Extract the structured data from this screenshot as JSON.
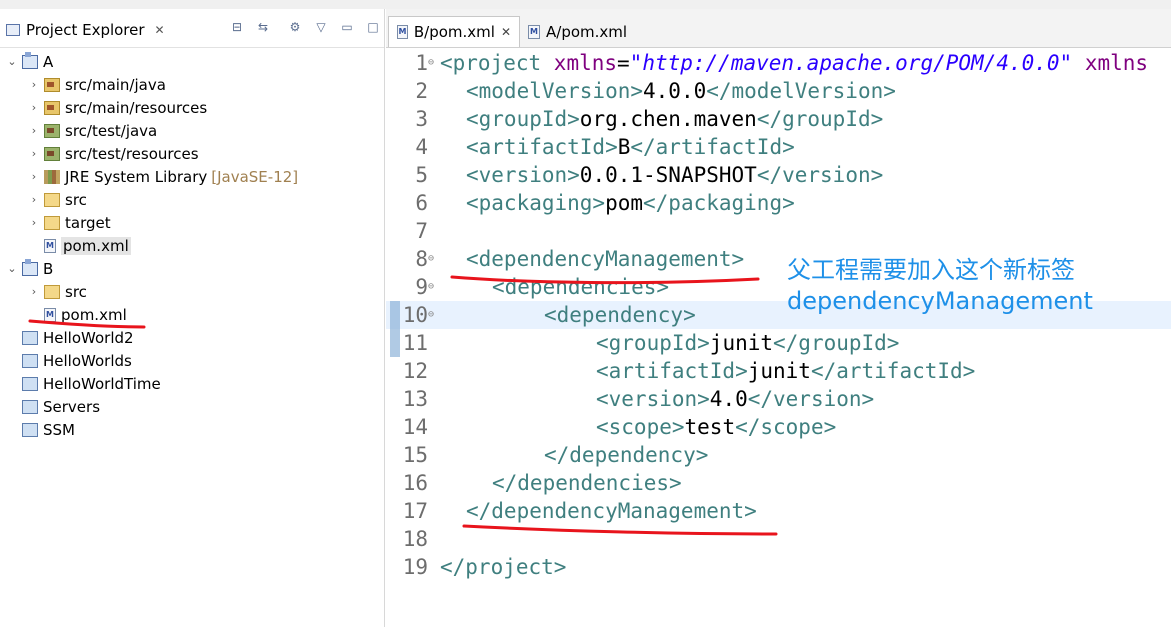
{
  "left_view": {
    "tab_title": "Project Explorer",
    "tab_close": "✕"
  },
  "tree": [
    {
      "label": "A",
      "icon": "project-icon",
      "twisty": "v"
    },
    {
      "label": "src/main/java",
      "icon": "source-folder-icon",
      "twisty": ">"
    },
    {
      "label": "src/main/resources",
      "icon": "source-folder-icon",
      "twisty": ">"
    },
    {
      "label": "src/test/java",
      "icon": "test-source-folder-icon",
      "twisty": ">"
    },
    {
      "label": "src/test/resources",
      "icon": "test-source-folder-icon",
      "twisty": ">"
    },
    {
      "label": "JRE System Library",
      "decoration": "[JavaSE-12]",
      "icon": "library-icon",
      "twisty": ">"
    },
    {
      "label": "src",
      "icon": "folder-icon",
      "twisty": ">"
    },
    {
      "label": "target",
      "icon": "folder-icon",
      "twisty": ">"
    },
    {
      "label": "pom.xml",
      "icon": "maven-file-icon",
      "twisty": ""
    },
    {
      "label": "B",
      "icon": "project-icon",
      "twisty": "v"
    },
    {
      "label": "src",
      "icon": "folder-icon",
      "twisty": ">"
    },
    {
      "label": "pom.xml",
      "icon": "maven-file-icon",
      "twisty": ""
    },
    {
      "label": "HelloWorld2",
      "icon": "closed-project-icon",
      "twisty": ""
    },
    {
      "label": "HelloWorlds",
      "icon": "closed-project-icon",
      "twisty": ""
    },
    {
      "label": "HelloWorldTime",
      "icon": "closed-project-icon",
      "twisty": ""
    },
    {
      "label": "Servers",
      "icon": "closed-project-icon",
      "twisty": ""
    },
    {
      "label": "SSM",
      "icon": "closed-project-icon",
      "twisty": ""
    }
  ],
  "editor": {
    "tabs": [
      {
        "label": "B/pom.xml",
        "close": "✕"
      },
      {
        "label": "A/pom.xml"
      }
    ],
    "lines": [
      {
        "n": "1",
        "fold": "⊖"
      },
      {
        "n": "2"
      },
      {
        "n": "3"
      },
      {
        "n": "4"
      },
      {
        "n": "5"
      },
      {
        "n": "6"
      },
      {
        "n": "7"
      },
      {
        "n": "8",
        "fold": "⊖"
      },
      {
        "n": "9",
        "fold": "⊖"
      },
      {
        "n": "10",
        "fold": "⊖"
      },
      {
        "n": "11"
      },
      {
        "n": "12"
      },
      {
        "n": "13"
      },
      {
        "n": "14"
      },
      {
        "n": "15"
      },
      {
        "n": "16"
      },
      {
        "n": "17"
      },
      {
        "n": "18"
      },
      {
        "n": "19"
      }
    ],
    "code": {
      "l1_open": "<project ",
      "l1_attr": "xmlns",
      "l1_eq": "=",
      "l1_val": "\"http://maven.apache.org/POM/4.0.0\"",
      "l1_attr2": " xmlns",
      "l2_open": "<modelVersion>",
      "l2_text": "4.0.0",
      "l2_close": "</modelVersion>",
      "l3_open": "<groupId>",
      "l3_text": "org.chen.maven",
      "l3_close": "</groupId>",
      "l4_open": "<artifactId>",
      "l4_text": "B",
      "l4_close": "</artifactId>",
      "l5_open": "<version>",
      "l5_text": "0.0.1-SNAPSHOT",
      "l5_close": "</version>",
      "l6_open": "<packaging>",
      "l6_text": "pom",
      "l6_close": "</packaging>",
      "l8": "<dependencyManagement>",
      "l9": "<dependencies>",
      "l10": "<dependency>",
      "l11_open": "<groupId>",
      "l11_text": "junit",
      "l11_close": "</groupId>",
      "l12_open": "<artifactId>",
      "l12_text": "junit",
      "l12_close": "</artifactId>",
      "l13_open": "<version>",
      "l13_text": "4.0",
      "l13_close": "</version>",
      "l14_open": "<scope>",
      "l14_text": "test",
      "l14_close": "</scope>",
      "l15": "</dependency>",
      "l16": "</dependencies>",
      "l17": "</dependencyManagement>",
      "l19": "</project>"
    }
  },
  "annotation": {
    "line1": "父工程需要加入这个新标签",
    "line2": "dependencyManagement",
    "color": "#1e90e8",
    "underline_color": "#e8141c"
  },
  "colors": {
    "tag": "#3f7f7f",
    "attribute": "#7f007f",
    "string": "#2a00ff",
    "current_line": "#e8f2fe"
  }
}
